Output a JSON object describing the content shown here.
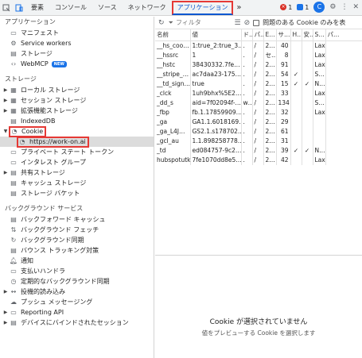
{
  "topbar": {
    "tabs": [
      "要素",
      "コンソール",
      "ソース",
      "ネットワーク",
      "アプリケーション"
    ],
    "active_tab": "アプリケーション",
    "more": "»",
    "error_count": "1",
    "message_count": "1",
    "profile_letter": "C"
  },
  "sidebar": {
    "sections": [
      {
        "title": "アプリケーション"
      },
      {
        "title": "ストレージ"
      },
      {
        "title": "バックグラウンド サービス"
      }
    ],
    "app_items": [
      "マニフェスト",
      "Service workers",
      "ストレージ",
      "WebMCP"
    ],
    "new_badge": "NEW",
    "storage_items": [
      "ローカル ストレージ",
      "セッション ストレージ",
      "拡張機能ストレージ",
      "IndexedDB",
      "Cookie",
      "https://work-on.ai",
      "プライベート ステート トークン",
      "インタレスト グループ",
      "共有ストレージ",
      "キャッシュ ストレージ",
      "ストレージ バケット"
    ],
    "bg_items": [
      "バックフォワード キャッシュ",
      "バックグラウンド フェッチ",
      "バックグラウンド同期",
      "バウンス トラッキング対策",
      "通知",
      "支払いハンドラ",
      "定期的なバックグラウンド同期",
      "投機的読み込み",
      "プッシュ メッセージング",
      "Reporting API",
      "デバイスにバインドされたセッション"
    ]
  },
  "toolbar": {
    "filter_placeholder": "フィルタ",
    "checkbox_label": "問題のある Cookie のみを表"
  },
  "table": {
    "headers": [
      "名前",
      "値",
      "ド…",
      "パ…",
      "E…",
      "サ…",
      "H…",
      "安…",
      "S…",
      "パ…"
    ],
    "rows": [
      [
        "__hs_coo…",
        "1:true_2:true_3…",
        ".",
        "/",
        "2…",
        "40",
        "",
        "",
        "Lax",
        ""
      ],
      [
        "__hssrc",
        "1",
        ".",
        "/",
        "セ…",
        "8",
        "",
        "",
        "Lax",
        ""
      ],
      [
        "__hstc",
        "38430332.7fe…",
        ".",
        "/",
        "2…",
        "91",
        "",
        "",
        "Lax",
        ""
      ],
      [
        "__stripe_…",
        "ac7daa23-175…",
        ".",
        "/",
        "2…",
        "54",
        "✓",
        "",
        "S…",
        ""
      ],
      [
        "__td_sign…",
        "true",
        ".",
        "/",
        "2…",
        "15",
        "✓",
        "✓",
        "N…",
        ""
      ],
      [
        "_clck",
        "1uh9bhx%5E2…",
        ".",
        "/",
        "2…",
        "33",
        "",
        "",
        "Lax",
        ""
      ],
      [
        "_dd_s",
        "aid=7f02094f-…",
        "w…",
        "/",
        "2…",
        "134",
        "",
        "",
        "S…",
        ""
      ],
      [
        "_fbp",
        "fb.1.17859909…",
        ".",
        "/",
        "2…",
        "32",
        "",
        "",
        "Lax",
        ""
      ],
      [
        "_ga",
        "GA1.1.6018169…",
        ".",
        "/",
        "2…",
        "29",
        "",
        "",
        "",
        ""
      ],
      [
        "_ga_L4J…",
        "GS2.1.s178702…",
        ".",
        "/",
        "2…",
        "61",
        "",
        "",
        "",
        ""
      ],
      [
        "_gcl_au",
        "1.1.898258778…",
        ".",
        "/",
        "2…",
        "31",
        "",
        "",
        "",
        ""
      ],
      [
        "_td",
        "ed084757-9c2…",
        ".",
        "/",
        "2…",
        "39",
        "✓",
        "✓",
        "N…",
        ""
      ],
      [
        "hubspotutk",
        "7fe1070dd8e5…",
        ".",
        "/",
        "2…",
        "42",
        "",
        "",
        "Lax",
        ""
      ]
    ]
  },
  "preview": {
    "title": "Cookie が選択されていません",
    "subtitle": "値をプレビューする Cookie を選択します"
  },
  "colors": {
    "accent": "#0b57d0",
    "highlight": "#e53935",
    "selected": "#dcdcdc"
  }
}
